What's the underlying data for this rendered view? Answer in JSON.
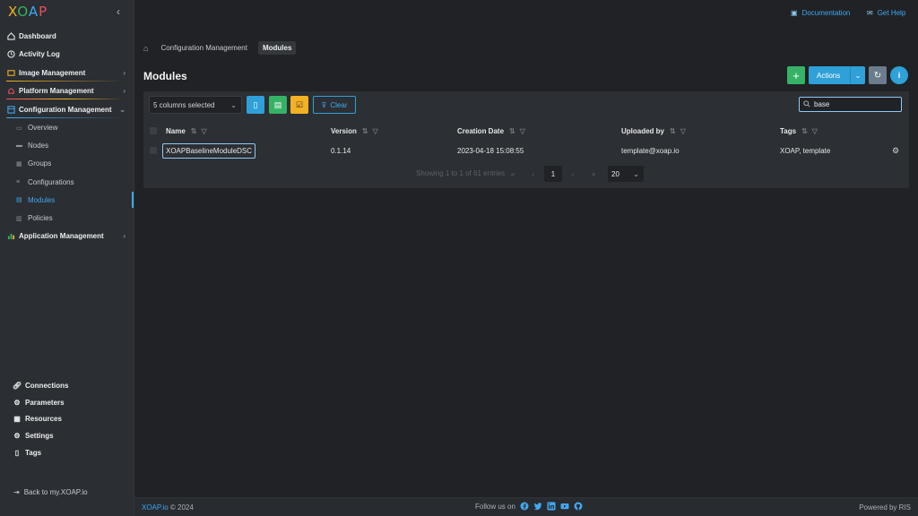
{
  "app": {
    "logo_text": "XOAP",
    "logo_colors": [
      "#f0b429",
      "#35b266",
      "#3fa9f5",
      "#e8505b"
    ]
  },
  "colors": {
    "accent": "#2fa0d8",
    "success": "#35b266",
    "warning": "#f3b223",
    "background": "#202225",
    "sidebar": "#2b2e32"
  },
  "topbar": {
    "documentation": "Documentation",
    "help": "Get Help"
  },
  "sidebar": {
    "items": [
      {
        "label": "Dashboard",
        "icon": "dashboard-icon"
      },
      {
        "label": "Activity Log",
        "icon": "clock-icon"
      },
      {
        "label": "Image Management",
        "icon": "image-icon",
        "underline": "#f3b223"
      },
      {
        "label": "Platform Management",
        "icon": "platform-icon",
        "underline": "#e8505b"
      },
      {
        "label": "Configuration Management",
        "icon": "config-icon",
        "underline": "#3fa9f5"
      },
      {
        "label": "Application Management",
        "icon": "app-icon"
      }
    ],
    "sub_items": [
      {
        "label": "Overview",
        "icon": "folder-icon"
      },
      {
        "label": "Nodes",
        "icon": "node-icon"
      },
      {
        "label": "Groups",
        "icon": "group-icon"
      },
      {
        "label": "Configurations",
        "icon": "layers-icon"
      },
      {
        "label": "Modules",
        "icon": "module-icon",
        "active": true
      },
      {
        "label": "Policies",
        "icon": "policy-icon"
      }
    ],
    "bottom_items": [
      {
        "label": "Connections",
        "icon": "link-icon"
      },
      {
        "label": "Parameters",
        "icon": "parameters-icon"
      },
      {
        "label": "Resources",
        "icon": "resources-icon"
      },
      {
        "label": "Settings",
        "icon": "gear-icon"
      },
      {
        "label": "Tags",
        "icon": "bookmark-icon"
      }
    ],
    "back_link": "Back to my.XOAP.io"
  },
  "breadcrumb": {
    "items": [
      "Configuration Management"
    ],
    "current": "Modules"
  },
  "page": {
    "title": "Modules",
    "actions_label": "Actions"
  },
  "toolbar": {
    "columns_selected": "5 columns selected",
    "clear_label": "Clear",
    "search_value": "base"
  },
  "table": {
    "columns": [
      "Name",
      "Version",
      "Creation Date",
      "Uploaded by",
      "Tags"
    ],
    "rows": [
      {
        "name": "XOAPBaselineModuleDSC",
        "version": "0.1.14",
        "creation_date": "2023-04-18 15:08:55",
        "uploaded_by": "template@xoap.io",
        "tags": "XOAP, template"
      }
    ]
  },
  "pagination": {
    "summary": "Showing 1 to 1 of 61 entries",
    "current_page": "1",
    "page_size": "20"
  },
  "footer": {
    "brand": "XOAP.io",
    "copyright": "© 2024",
    "follow": "Follow us on",
    "social": [
      "facebook-icon",
      "twitter-icon",
      "linkedin-icon",
      "youtube-icon",
      "github-icon"
    ],
    "powered": "Powered by RIS"
  }
}
